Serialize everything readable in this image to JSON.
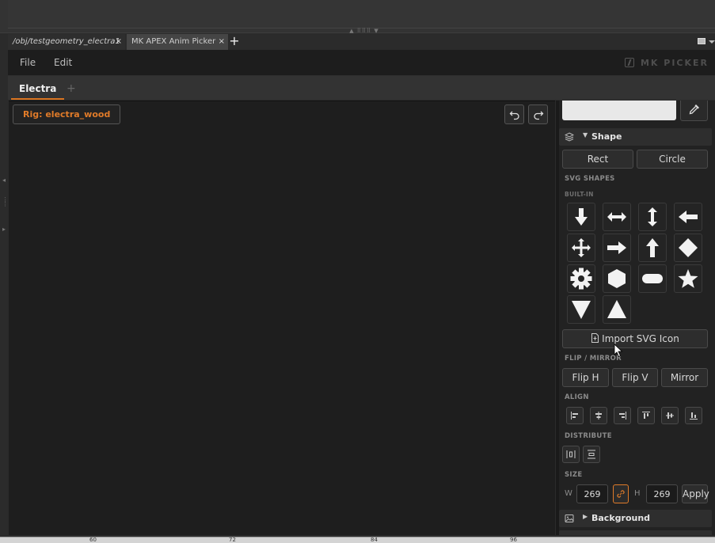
{
  "pane_tabs": [
    {
      "label": "/obj/testgeometry_electra1",
      "close": "×"
    },
    {
      "label": "MK APEX Anim Picker",
      "close": "×"
    }
  ],
  "pane_tab_add": "+",
  "menu": {
    "file": "File",
    "edit": "Edit"
  },
  "brand": "MK PICKER",
  "tabs": {
    "active": "Electra",
    "add": "+"
  },
  "canvas": {
    "rig_label": "Rig: electra_wood"
  },
  "colors": {
    "accent": "#e07b29",
    "swatch": "#e8e8e8",
    "background": "#1e1e1e"
  },
  "panel": {
    "shape_section": "Shape",
    "rect": "Rect",
    "circle": "Circle",
    "svg_shapes_label": "SVG SHAPES",
    "built_in_label": "BUILT-IN",
    "shapes": [
      "arrow-down-icon",
      "arrow-left-right-icon",
      "arrow-up-down-icon",
      "arrow-left-icon",
      "move-icon",
      "arrow-right-icon",
      "arrow-up-icon",
      "diamond-icon",
      "gear-icon",
      "hexagon-icon",
      "pill-icon",
      "star-icon",
      "triangle-down-icon",
      "triangle-up-icon"
    ],
    "import_svg": "Import SVG Icon",
    "flip_label": "FLIP / MIRROR",
    "flip_h": "Flip H",
    "flip_v": "Flip V",
    "mirror": "Mirror",
    "align_label": "ALIGN",
    "distribute_label": "DISTRIBUTE",
    "size_label": "SIZE",
    "w_label": "W",
    "h_label": "H",
    "width": "269",
    "height": "269",
    "apply": "Apply",
    "background_section": "Background"
  },
  "ruler": [
    "60",
    "72",
    "84",
    "96"
  ]
}
